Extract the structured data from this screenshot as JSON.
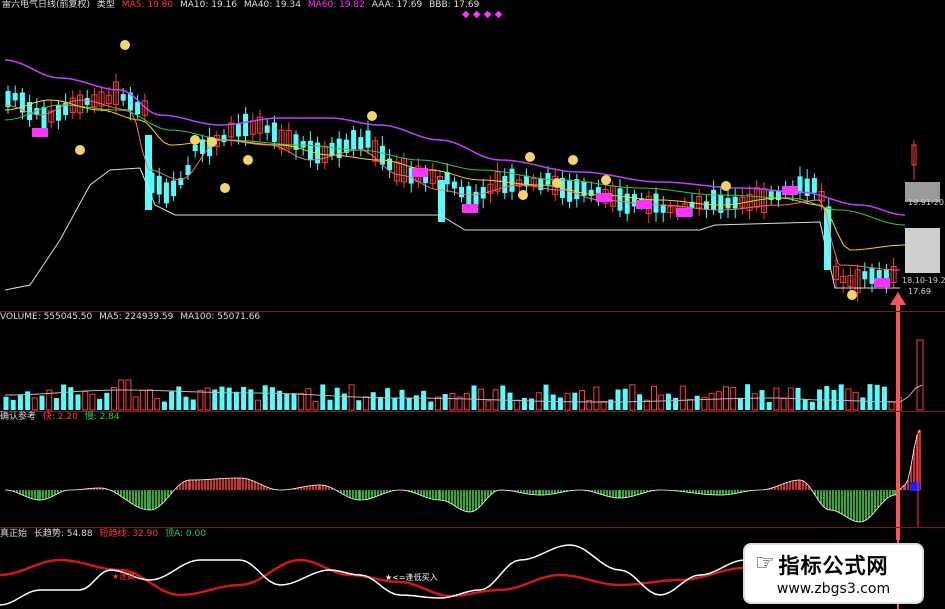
{
  "header": {
    "main_title": "雷六电气日线(前复权)",
    "main_sub": "类型",
    "ma5": "MA5: 19.80",
    "ma10": "MA10: 19.16",
    "ma40": "MA40: 19.34",
    "ma_pink": "MA60: 19.82",
    "aaa": "AAA: 17.69",
    "bbb": "BBB: 17.69",
    "volume_label": "VOLUME: 555045.50",
    "vol_ma5": "MA5: 224939.59",
    "vol_ma100": "MA100: 55071.66",
    "sub2_title": "确认参考",
    "sub2_a": "快: 2.20",
    "sub2_b": "慢: 2.84",
    "sub3_title": "真正始",
    "sub3_a": "长趋势: 54.88",
    "sub3_b": "短趋线: 32.90",
    "sub3_c": "顶A: 0.00",
    "annot_buy": "★<=逢低买入",
    "annot_left": "★逢高"
  },
  "price_labels": {
    "upper": "19.91-20.20",
    "lower": "18.10-19.20",
    "low": "17.69"
  },
  "watermark": {
    "line1": "指标公式网",
    "line2": "www.zbgs3.com"
  },
  "colors": {
    "up": "#ff3b3b",
    "down": "#54ffff",
    "ma5": "#ffffff",
    "ma10": "#ffd700",
    "ma40": "#2ecc40",
    "ma60": "#c040ff",
    "pink": "#ff33ff",
    "background": "#000000",
    "separator": "#7a1a1a"
  },
  "chart_data": {
    "type": "line",
    "title": "雷六电气日线(前复权)",
    "series": [
      {
        "name": "MA5",
        "values": [
          19.8
        ]
      },
      {
        "name": "MA10",
        "values": [
          19.16
        ]
      },
      {
        "name": "MA40",
        "values": [
          19.34
        ]
      },
      {
        "name": "MA60",
        "values": [
          19.82
        ]
      }
    ]
  }
}
